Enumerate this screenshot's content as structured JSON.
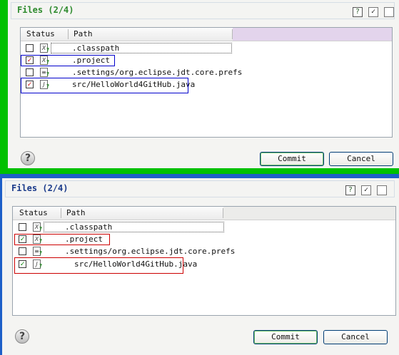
{
  "dialog": {
    "title": "Files (2/4)",
    "columns": {
      "status": "Status",
      "path": "Path"
    },
    "files": [
      {
        "checked": false,
        "icon": "classpath-file-icon",
        "path": ".classpath"
      },
      {
        "checked": true,
        "icon": "project-file-icon",
        "path": ".project"
      },
      {
        "checked": false,
        "icon": "text-file-icon",
        "path": ".settings/org.eclipse.jdt.core.prefs"
      },
      {
        "checked": true,
        "icon": "java-file-icon",
        "path": "src/HelloWorld4GitHub.java"
      }
    ],
    "buttons": {
      "commit": "Commit",
      "cancel": "Cancel"
    },
    "toolbar_icons": {
      "help": "?",
      "check_all": "✓"
    }
  },
  "panels": [
    {
      "id": "top",
      "frame_color": "#00c000",
      "title_color": "#2e8b2e",
      "highlight_color": "#0000cc"
    },
    {
      "id": "bottom",
      "frame_color": "#1e5fc8",
      "title_color": "#1a3a8a",
      "highlight_color": "#cc0000"
    }
  ]
}
